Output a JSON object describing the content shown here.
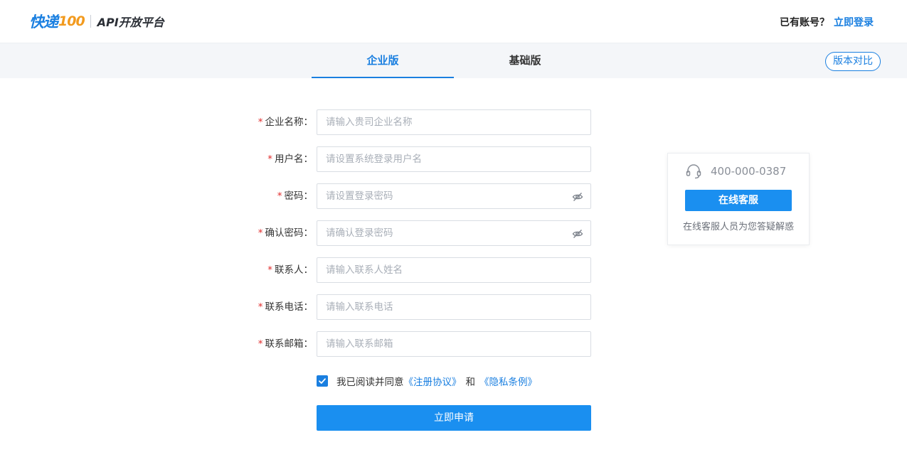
{
  "header": {
    "logo_brand": "快递",
    "logo_number": "100",
    "logo_subtitle": "API开放平台",
    "account_question": "已有账号？",
    "login_link": "立即登录"
  },
  "tabs": [
    {
      "label": "企业版",
      "active": true
    },
    {
      "label": "基础版",
      "active": false
    }
  ],
  "compare_button": "版本对比",
  "form": {
    "fields": [
      {
        "label": "企业名称：",
        "placeholder": "请输入贵司企业名称"
      },
      {
        "label": "用户名：",
        "placeholder": "请设置系统登录用户名"
      },
      {
        "label": "密码：",
        "placeholder": "请设置登录密码",
        "icon": "eye-hidden-icon"
      },
      {
        "label": "确认密码：",
        "placeholder": "请确认登录密码",
        "icon": "eye-hidden-icon"
      },
      {
        "label": "联系人：",
        "placeholder": "请输入联系人姓名"
      },
      {
        "label": "联系电话：",
        "placeholder": "请输入联系电话"
      },
      {
        "label": "联系邮箱：",
        "placeholder": "请输入联系邮箱"
      }
    ],
    "required_mark": "*",
    "agreement": {
      "checked": true,
      "prefix": "我已阅读并同意",
      "terms_link": "《注册协议》",
      "and": "和",
      "privacy_link": "《隐私条例》"
    },
    "submit_label": "立即申请"
  },
  "service": {
    "icon": "headset-icon",
    "phone": "400-000-0387",
    "button_label": "在线客服",
    "description": "在线客服人员为您答疑解惑"
  },
  "colors": {
    "accent": "#1a7fe0",
    "button": "#1a8ff0",
    "logo_orange": "#f29a1e",
    "required": "#e02b2b",
    "tabbar_bg": "#f4f6f9"
  }
}
